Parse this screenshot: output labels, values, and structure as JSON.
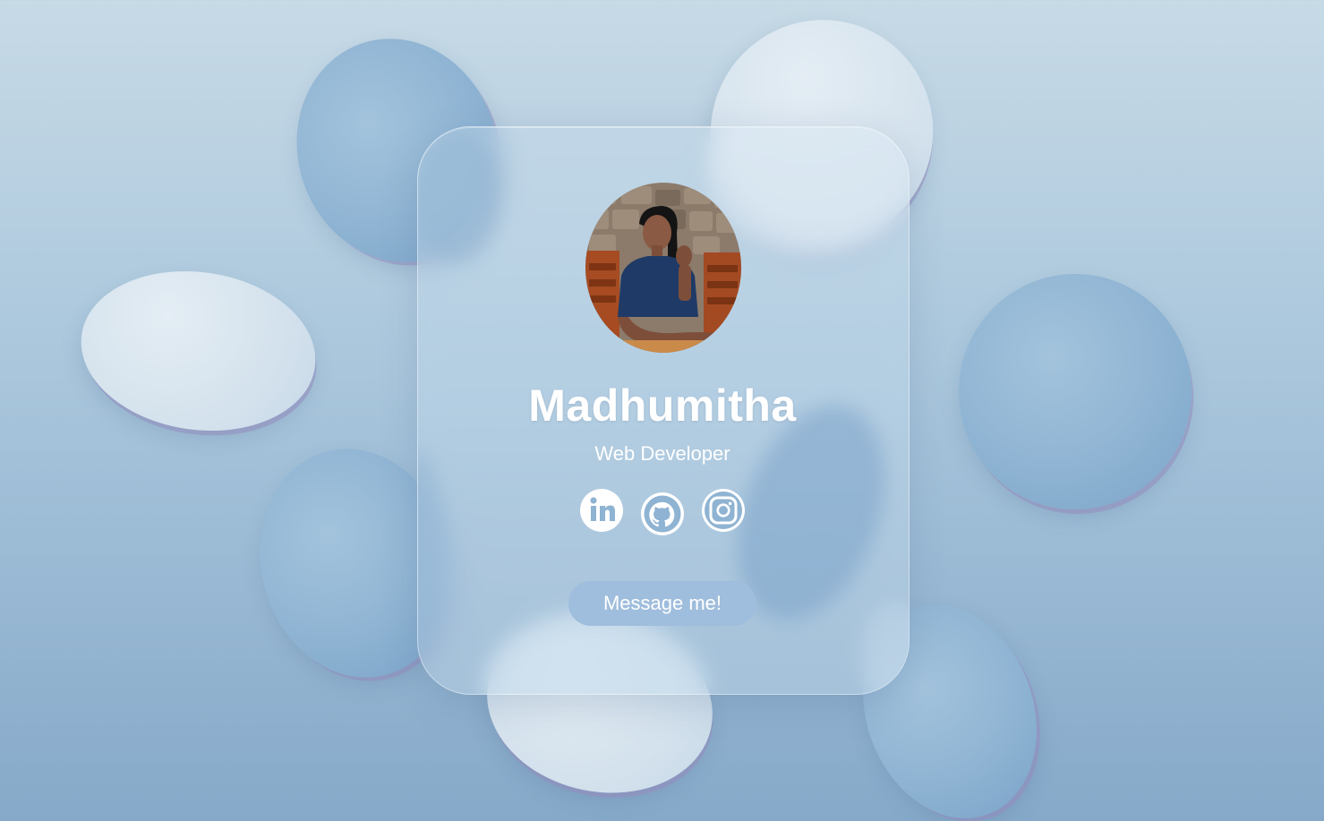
{
  "profile": {
    "name": "Madhumitha",
    "role": "Web Developer",
    "avatar_alt": "profile photo"
  },
  "social_links": [
    {
      "name": "linkedin",
      "icon": "linkedin-icon"
    },
    {
      "name": "github",
      "icon": "github-icon"
    },
    {
      "name": "instagram",
      "icon": "instagram-icon"
    }
  ],
  "cta": {
    "label": "Message me!"
  },
  "colors": {
    "background_top": "#c7dae6",
    "background_bottom": "#86a9c9",
    "button": "#9fbddc",
    "text": "#ffffff"
  }
}
